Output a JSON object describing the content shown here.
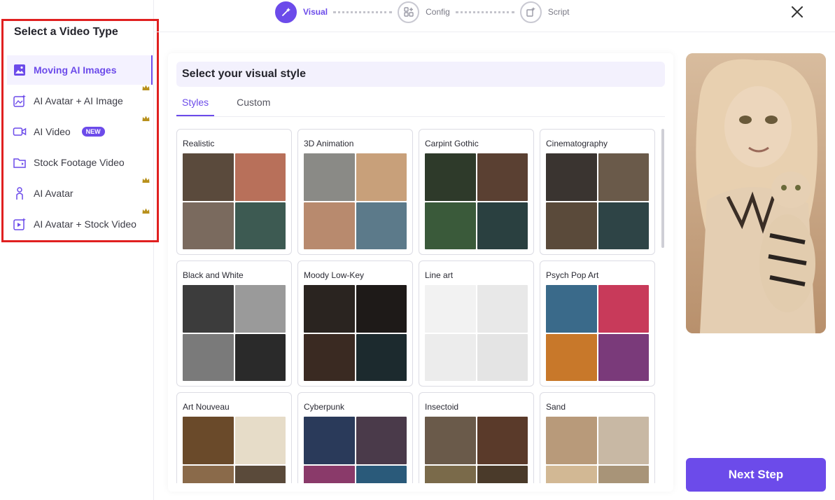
{
  "sidebar": {
    "title": "Select a Video Type",
    "items": [
      {
        "label": "Moving AI Images",
        "icon": "image-icon",
        "active": true,
        "premium": false
      },
      {
        "label": "AI Avatar + AI Image",
        "icon": "sparkle-image-icon",
        "active": false,
        "premium": true
      },
      {
        "label": "AI Video",
        "icon": "video-camera-icon",
        "active": false,
        "premium": true,
        "badge": "NEW"
      },
      {
        "label": "Stock Footage Video",
        "icon": "folder-icon",
        "active": false,
        "premium": false
      },
      {
        "label": "AI Avatar",
        "icon": "person-icon",
        "active": false,
        "premium": true
      },
      {
        "label": "AI Avatar + Stock Video",
        "icon": "play-sparkle-icon",
        "active": false,
        "premium": true
      }
    ]
  },
  "stepper": {
    "steps": [
      {
        "label": "Visual",
        "active": true
      },
      {
        "label": "Config",
        "active": false
      },
      {
        "label": "Script",
        "active": false
      }
    ]
  },
  "main": {
    "heading": "Select your visual style",
    "tabs": [
      {
        "label": "Styles",
        "active": true
      },
      {
        "label": "Custom",
        "active": false
      }
    ],
    "styles": [
      {
        "label": "Realistic",
        "colors": [
          "#5a4a3c",
          "#b8705a",
          "#7a6a5e",
          "#3d5a52"
        ]
      },
      {
        "label": "3D Animation",
        "colors": [
          "#8a8a86",
          "#c8a07a",
          "#b88a6e",
          "#5c7a8a"
        ]
      },
      {
        "label": "Carpint Gothic",
        "colors": [
          "#2e3a2a",
          "#5a4032",
          "#3a5a3a",
          "#2a4040"
        ]
      },
      {
        "label": "Cinematography",
        "colors": [
          "#3a3430",
          "#6a5a4a",
          "#5a4a3a",
          "#2e4446"
        ]
      },
      {
        "label": "Black and White",
        "colors": [
          "#3c3c3c",
          "#9a9a9a",
          "#7a7a7a",
          "#2a2a2a"
        ]
      },
      {
        "label": "Moody Low-Key",
        "colors": [
          "#2a2420",
          "#1e1a18",
          "#3a2a22",
          "#1c2a2e"
        ]
      },
      {
        "label": "Line art",
        "colors": [
          "#f2f2f2",
          "#e8e8e8",
          "#ececec",
          "#e4e4e4"
        ]
      },
      {
        "label": "Psych Pop Art",
        "colors": [
          "#3a6a8a",
          "#c83a5a",
          "#c8782a",
          "#7a3a7a"
        ]
      },
      {
        "label": "Art Nouveau",
        "colors": [
          "#6a4a2a",
          "#e6dcc8",
          "#8a6a4a",
          "#5a4a3a"
        ]
      },
      {
        "label": "Cyberpunk",
        "colors": [
          "#2a3a5a",
          "#4a3a4a",
          "#8a3a6a",
          "#2a5a7a"
        ]
      },
      {
        "label": "Insectoid",
        "colors": [
          "#6a5a4a",
          "#5a3a2a",
          "#7a6a4a",
          "#4a3a2a"
        ]
      },
      {
        "label": "Sand",
        "colors": [
          "#b89a7a",
          "#c8b8a4",
          "#d2b894",
          "#a89478"
        ]
      }
    ]
  },
  "preview": {
    "caption": "preview-image"
  },
  "footer": {
    "next_label": "Next Step"
  },
  "theme": {
    "accent": "#6c4bea",
    "highlight_border": "#e02020"
  }
}
